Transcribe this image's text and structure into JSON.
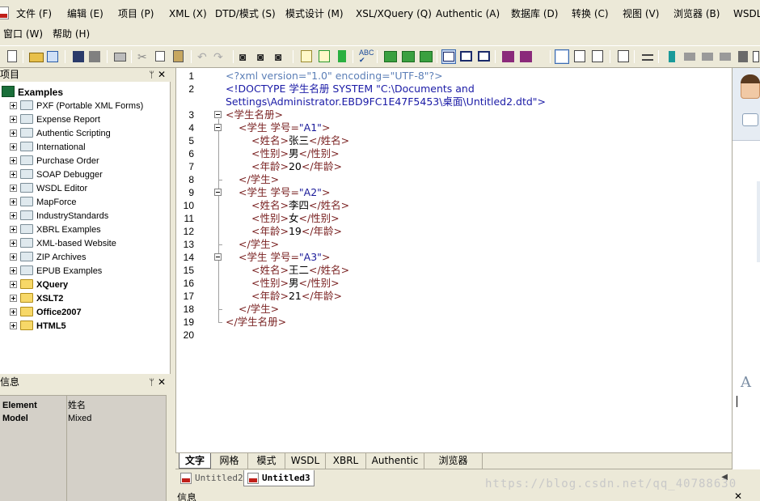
{
  "menubar": {
    "row1": [
      "文件 (F)",
      "编辑 (E)",
      "项目 (P)",
      "XML (X)",
      "DTD/模式 (S)",
      "模式设计 (M)",
      "XSL/XQuery (Q)",
      "Authentic (A)",
      "数据库 (D)",
      "转换 (C)",
      "视图 (V)",
      "浏览器 (B)",
      "WSDL"
    ],
    "row2": [
      "窗口 (W)",
      "帮助 (H)"
    ]
  },
  "project_panel": {
    "title": "项目",
    "root": "Examples",
    "items": [
      {
        "label": "PXF (Portable XML Forms)",
        "bold": false
      },
      {
        "label": "Expense Report",
        "bold": false
      },
      {
        "label": "Authentic Scripting",
        "bold": false
      },
      {
        "label": "International",
        "bold": false
      },
      {
        "label": "Purchase Order",
        "bold": false
      },
      {
        "label": "SOAP Debugger",
        "bold": false
      },
      {
        "label": "WSDL Editor",
        "bold": false
      },
      {
        "label": "MapForce",
        "bold": false
      },
      {
        "label": "IndustryStandards",
        "bold": false
      },
      {
        "label": "XBRL Examples",
        "bold": false
      },
      {
        "label": "XML-based Website",
        "bold": false
      },
      {
        "label": "ZIP Archives",
        "bold": false
      },
      {
        "label": "EPUB Examples",
        "bold": false
      },
      {
        "label": "XQuery",
        "bold": true
      },
      {
        "label": "XSLT2",
        "bold": true
      },
      {
        "label": "Office2007",
        "bold": true
      },
      {
        "label": "HTML5",
        "bold": true
      }
    ]
  },
  "info_panel": {
    "title": "信息",
    "rows": [
      {
        "key": "Element",
        "value": "姓名"
      },
      {
        "key": "Model",
        "value": "Mixed"
      }
    ]
  },
  "editor": {
    "line_numbers": [
      "1",
      "2",
      "",
      "3",
      "4",
      "5",
      "6",
      "7",
      "8",
      "9",
      "10",
      "11",
      "12",
      "13",
      "14",
      "15",
      "16",
      "17",
      "18",
      "19",
      "20"
    ],
    "line1": "<?xml version=\"1.0\" encoding=\"UTF-8\"?>",
    "line2a": "<!DOCTYPE 学生名册 SYSTEM \"C:\\Documents and",
    "line2b": "Settings\\Administrator.EBD9FC1E47F5453\\桌面\\Untitled2.dtd\">",
    "root_open": "学生名册",
    "students": [
      {
        "id_attr": "学号",
        "id": "A1",
        "name": "张三",
        "gender": "男",
        "age": "20"
      },
      {
        "id_attr": "学号",
        "id": "A2",
        "name": "李四",
        "gender": "女",
        "age": "19"
      },
      {
        "id_attr": "学号",
        "id": "A3",
        "name": "王二",
        "gender": "男",
        "age": "21"
      }
    ],
    "tag_student": "学生",
    "tag_name": "姓名",
    "tag_gender": "性别",
    "tag_age": "年龄"
  },
  "view_tabs": [
    "文字",
    "网格",
    "模式",
    "WSDL",
    "XBRL",
    "Authentic",
    "浏览器"
  ],
  "active_view_tab": "文字",
  "doc_tabs": [
    {
      "label": "Untitled2",
      "active": false
    },
    {
      "label": "Untitled3",
      "active": true
    }
  ],
  "bottom_info_label": "信息",
  "watermark": "https://blog.csdn.net/qq_40788630",
  "colors": {
    "pi": "#5c7fb7",
    "tag": "#7a2222",
    "attribute_value": "#1a1a99",
    "doctype": "#1a1aa6"
  }
}
